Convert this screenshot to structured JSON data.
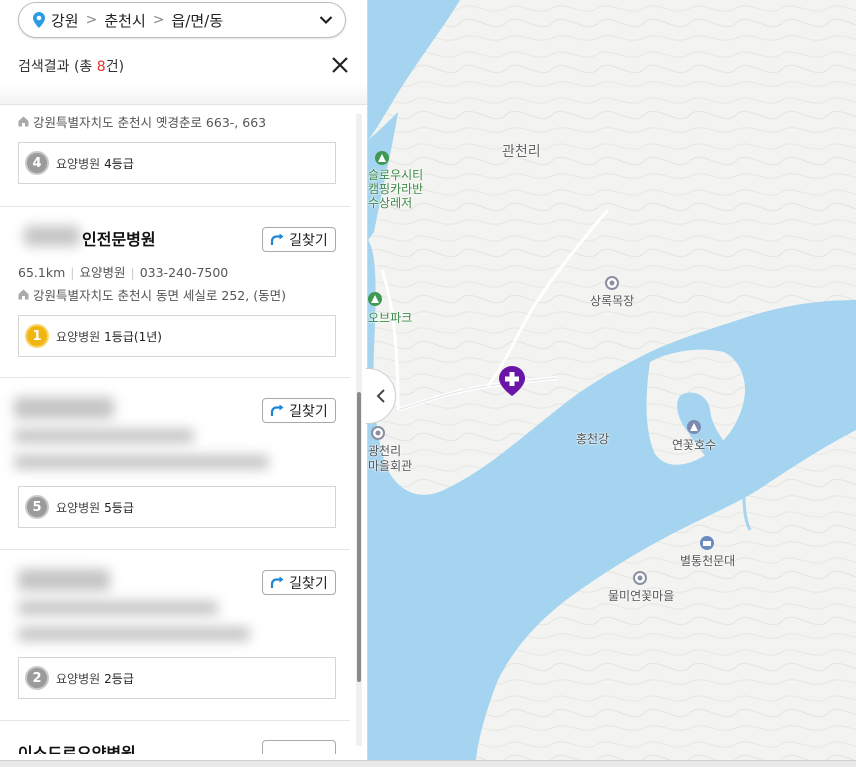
{
  "region": {
    "province": "강원",
    "city": "춘천시",
    "district": "읍/면/동",
    "separator": ">"
  },
  "results": {
    "prefix": "검색결과 (총 ",
    "count": "8",
    "suffix": "건)"
  },
  "route_label": "길찾기",
  "items": [
    {
      "address": "강원특별자치도 춘천시 옛경춘로 663-, 663",
      "grade_type": "요양병원",
      "grade_num": "4",
      "grade_value": "4등급"
    },
    {
      "name": "인전문병원",
      "distance": "65.1km",
      "category": "요양병원",
      "phone": "033-240-7500",
      "address": "강원특별자치도 춘천시 동면 세실로 252, (동면)",
      "grade_type": "요양병원",
      "grade_num": "1",
      "grade_value": "1등급(1년)"
    },
    {
      "grade_type": "요양병원",
      "grade_num": "5",
      "grade_value": "5등급"
    },
    {
      "grade_type": "요양병원",
      "grade_num": "2",
      "grade_value": "2등급"
    },
    {
      "name": "이소드로요양병원"
    }
  ],
  "map": {
    "labels": [
      "관천리",
      "슬로우시티",
      "캠핑카라반",
      "수상레저",
      "상록목장",
      "오브파크",
      "광천리",
      "마을회관",
      "홍천강",
      "연꽃호수",
      "별통천문대",
      "물미연꽃마을"
    ]
  },
  "colors": {
    "water": "#a4d4f0",
    "land": "#f3f4f1",
    "marker": "#6a14a8",
    "accent": "#2a9be5",
    "count": "#e5322d"
  }
}
